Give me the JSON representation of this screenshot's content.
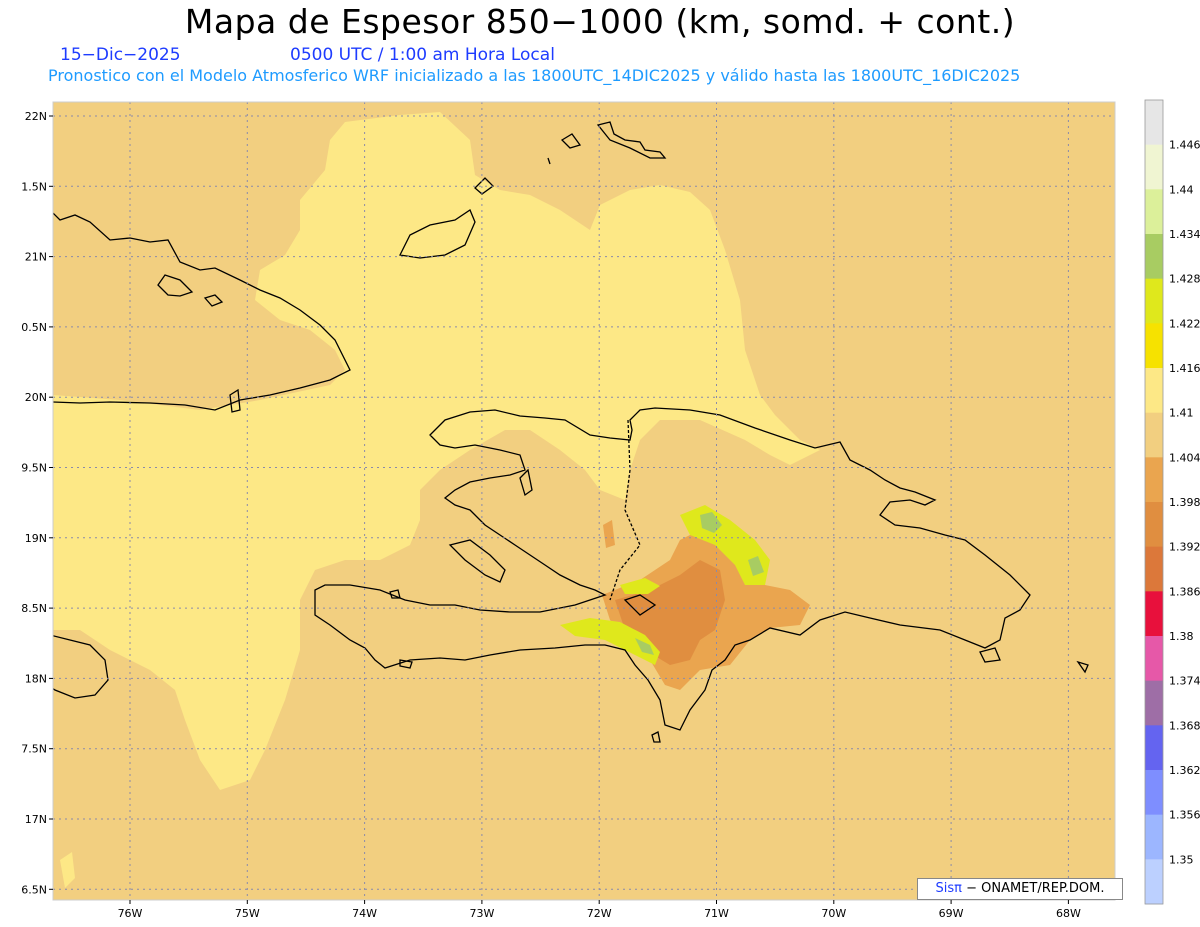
{
  "header": {
    "title": "Mapa de Espesor 850−1000 (km, somd. + cont.)",
    "date": "15−Dic−2025",
    "time": "0500 UTC / 1:00 am Hora Local",
    "subtitle": "Pronostico con el Modelo Atmosferico WRF inicializado a las 1800UTC_14DIC2025 y válido hasta las  1800UTC_16DIC2025"
  },
  "map": {
    "lat_labels": [
      "22N",
      "1.5N",
      "21N",
      "0.5N",
      "20N",
      "9.5N",
      "19N",
      "8.5N",
      "18N",
      "7.5N",
      "17N",
      "6.5N"
    ],
    "lon_labels": [
      "76W",
      "75W",
      "74W",
      "73W",
      "72W",
      "71W",
      "70W",
      "69W",
      "68W"
    ],
    "background_color": "#f2cf80",
    "shade_colors": {
      "c1404": "#f2cf80",
      "c1410": "#fde886",
      "c1398": "#eaa54f",
      "c1392": "#e08e40",
      "c1416": "#f6e200",
      "c1422": "#dfe81c",
      "c1428": "#a8cc62"
    }
  },
  "colorbar": {
    "labels": [
      "1.446",
      "1.44",
      "1.434",
      "1.428",
      "1.422",
      "1.416",
      "1.41",
      "1.404",
      "1.398",
      "1.392",
      "1.386",
      "1.38",
      "1.374",
      "1.368",
      "1.362",
      "1.356",
      "1.35"
    ],
    "colors": [
      "#e6e6e6",
      "#f0f5d2",
      "#dcf09a",
      "#a8cc62",
      "#dfe81c",
      "#f6e200",
      "#fde886",
      "#f2cf80",
      "#eaa54f",
      "#e08e40",
      "#dc783a",
      "#e8103c",
      "#e658a8",
      "#9e6ea6",
      "#6464f0",
      "#7e8eff",
      "#9cb6ff",
      "#bcd0ff"
    ]
  },
  "credit": {
    "brand": "Sisπ",
    "text": "− ONAMET/REP.DOM."
  }
}
